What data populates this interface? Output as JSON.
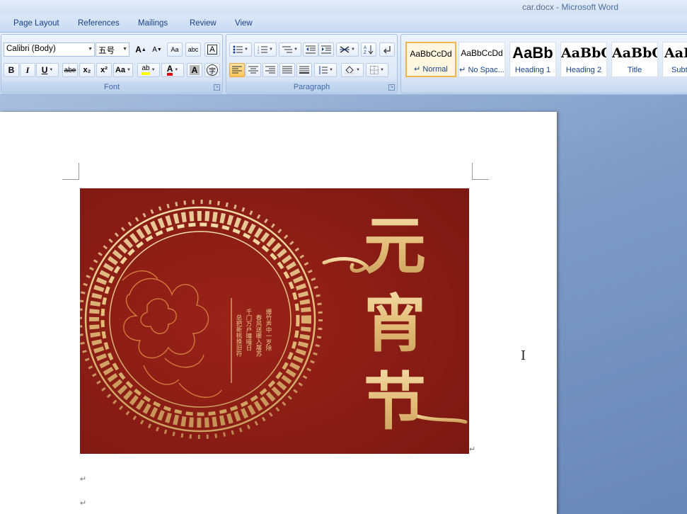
{
  "window": {
    "document": "car.docx",
    "separator": " - ",
    "app": "Microsoft Word"
  },
  "tabs": [
    "Page Layout",
    "References",
    "Mailings",
    "Review",
    "View"
  ],
  "font": {
    "name": "Calibri (Body)",
    "size": "五号",
    "group_label": "Font",
    "buttons": {
      "grow": "A",
      "shrink": "A",
      "clear": "Aa",
      "phonetic": "abc",
      "border": "A",
      "bold": "B",
      "italic": "I",
      "underline": "U",
      "strike": "abe",
      "subscript": "x₂",
      "superscript": "x²",
      "case": "Aa",
      "highlight": "ab",
      "color": "A",
      "shading": "A",
      "enclose": "字"
    }
  },
  "paragraph": {
    "group_label": "Paragraph"
  },
  "styles": [
    {
      "sample": "AaBbCcDd",
      "name": "↵ Normal"
    },
    {
      "sample": "AaBbCcDd",
      "name": "↵ No Spac..."
    },
    {
      "sample": "AaBb",
      "name": "Heading 1"
    },
    {
      "sample": "AaBbC",
      "name": "Heading 2"
    },
    {
      "sample": "AaBbC",
      "name": "Title"
    },
    {
      "sample": "AaBl",
      "name": "Subt"
    }
  ],
  "document": {
    "picture_title_chars": [
      "元",
      "宵",
      "节"
    ],
    "poem_lines": [
      "爆竹声中一岁除",
      "春风送暖入屠苏",
      "千门万户曈曈日",
      "总把新桃换旧符"
    ],
    "para_marks": [
      "↵",
      "↵",
      "↵"
    ]
  },
  "colors": {
    "picture_bg": "#8c1d17",
    "gold": "#e8c98a",
    "accent": "#f0b44c"
  }
}
